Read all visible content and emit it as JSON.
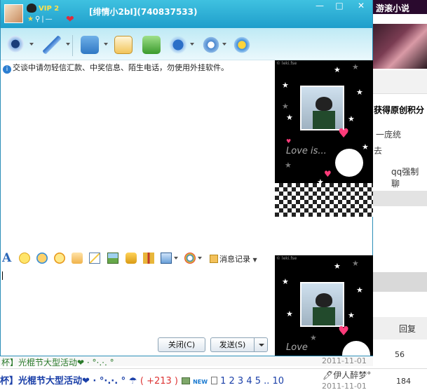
{
  "window": {
    "title": "[绯情小2bI](740837533)",
    "vip_label": "VIP 2",
    "controls": {
      "min": "—",
      "max": "□",
      "close": "✕"
    }
  },
  "toolbar": {
    "icons": [
      "video-call-icon",
      "voice-call-icon",
      "send-file-icon",
      "send-mail-icon",
      "create-group-icon",
      "app-center-icon",
      "settings-icon",
      "qq-show-icon"
    ]
  },
  "notice": "交谈中请勿轻信汇款、中奖信息、陌生电话，勿使用外挂软件。",
  "input_toolbar": {
    "font_glyph": "A",
    "history_label": "消息记录"
  },
  "buttons": {
    "close": "关闭(C)",
    "send": "发送(S)"
  },
  "qq_show": {
    "watermark": "© leki.fse",
    "love_text": "Love is..."
  },
  "background_page": {
    "banner": "游滚小说",
    "text1": "获得原创积分",
    "text2": "一庞统",
    "text3": "去",
    "text4": "qq强制聊",
    "reply_header": "回复",
    "reply_count_1": "56",
    "reply_count_2": "184",
    "date_1": "2011-11-01",
    "date_2": "2011-11-01",
    "author": "伊人醉梦°",
    "row1_text": "杯】光棍节大型活动❤ · °·.·. °",
    "row2_title": "杯】光棍节大型活动❤ · °·.·. °",
    "row2_score": "( +213 )",
    "row2_new": "NEW",
    "row2_pages": "1 2 3 4 5 .. 10"
  }
}
